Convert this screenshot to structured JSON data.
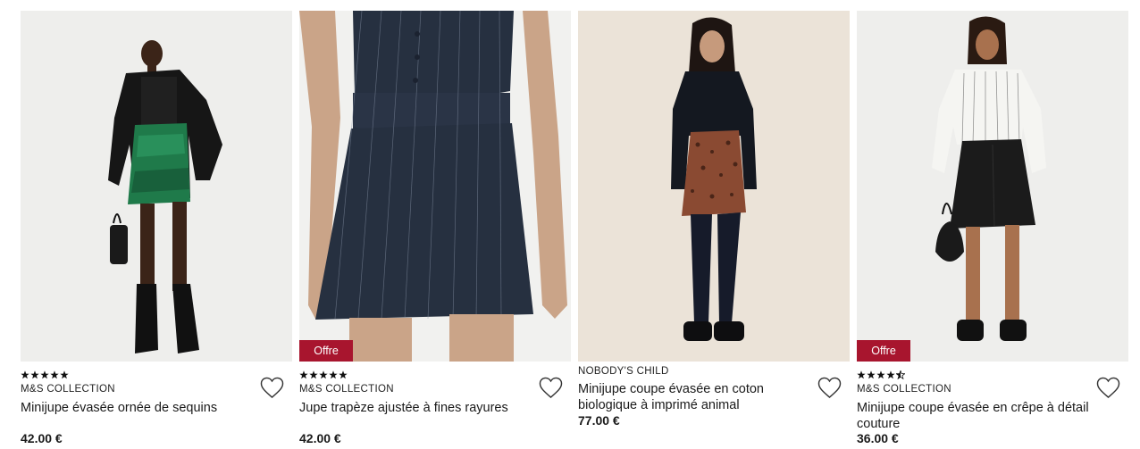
{
  "currency_note": "",
  "products": [
    {
      "rating_stars": 5,
      "brand": "M&S COLLECTION",
      "title": "Minijupe évasée ornée de sequins",
      "price": "42.00 €",
      "badge": "",
      "photo": {
        "bg": "#eeeeec",
        "skirt": "#1f7a4a",
        "top": "#151515"
      }
    },
    {
      "rating_stars": 5,
      "brand": "M&S COLLECTION",
      "title": "Jupe trapèze ajustée à fines rayures",
      "price": "42.00 €",
      "badge": "Offre",
      "photo": {
        "bg": "#f1f1ef",
        "skirt": "#263040",
        "top": "#263040"
      }
    },
    {
      "rating_stars": 0,
      "brand": "NOBODY'S CHILD",
      "title": "Minijupe coupe évasée en coton biologique à imprimé animal",
      "price": "77.00 €",
      "badge": "",
      "photo": {
        "bg": "#ebe3d8",
        "skirt": "#8a4a32",
        "top": "#141820"
      }
    },
    {
      "rating_stars": 4.5,
      "brand": "M&S COLLECTION",
      "title": "Minijupe coupe évasée en crêpe à détail couture",
      "price": "36.00 €",
      "badge": "Offre",
      "photo": {
        "bg": "#eeeeec",
        "skirt": "#1b1b1b",
        "top": "#f5f5f2"
      }
    }
  ],
  "badge_color": "#a8152e",
  "icons": {
    "wishlist": "heart-outline-icon",
    "rating": "star-icon"
  }
}
